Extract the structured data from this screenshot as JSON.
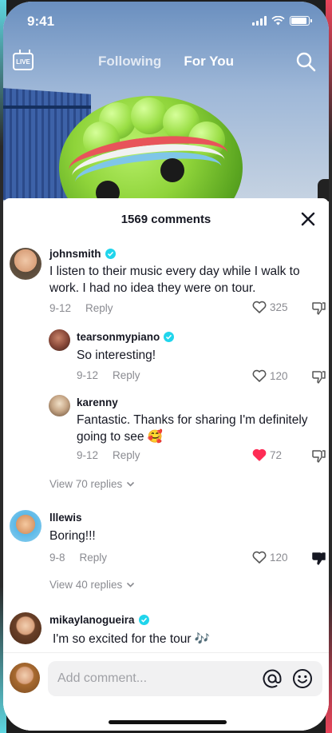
{
  "status": {
    "time": "9:41",
    "battery_level": 0.9
  },
  "topnav": {
    "live_label": "LIVE",
    "tabs": [
      {
        "label": "Following"
      },
      {
        "label": "For You"
      }
    ],
    "active_tab": "For You"
  },
  "sheet": {
    "count_label": "1569 comments"
  },
  "comments": [
    {
      "user": "johnsmith",
      "verified": true,
      "text": "I listen to their music every day while I walk to work. I had no idea they were on tour.",
      "date": "9-12",
      "reply_label": "Reply",
      "likes": "325",
      "liked": false
    },
    {
      "user": "tearsonmypiano",
      "verified": true,
      "text": "So interesting!",
      "date": "9-12",
      "reply_label": "Reply",
      "likes": "120",
      "liked": false
    },
    {
      "user": "karenny",
      "verified": false,
      "text": "Fantastic. Thanks for sharing I'm definitely going to see 🥰",
      "date": "9-12",
      "reply_label": "Reply",
      "likes": "72",
      "liked": true
    },
    {
      "user": "lllewis",
      "verified": false,
      "text": "Boring!!!",
      "date": "9-8",
      "reply_label": "Reply",
      "likes": "120",
      "liked": false,
      "disliked": true
    },
    {
      "user": "mikaylanogueira",
      "verified": true,
      "text": "I'm so excited for the tour 🎶"
    }
  ],
  "view_replies": [
    "View 70 replies",
    "View 40 replies"
  ],
  "composer": {
    "placeholder": "Add comment..."
  },
  "colors": {
    "verified": "#20d5ec",
    "like_active": "#fe2c55",
    "text": "#161823",
    "muted": "#8a8b91"
  }
}
